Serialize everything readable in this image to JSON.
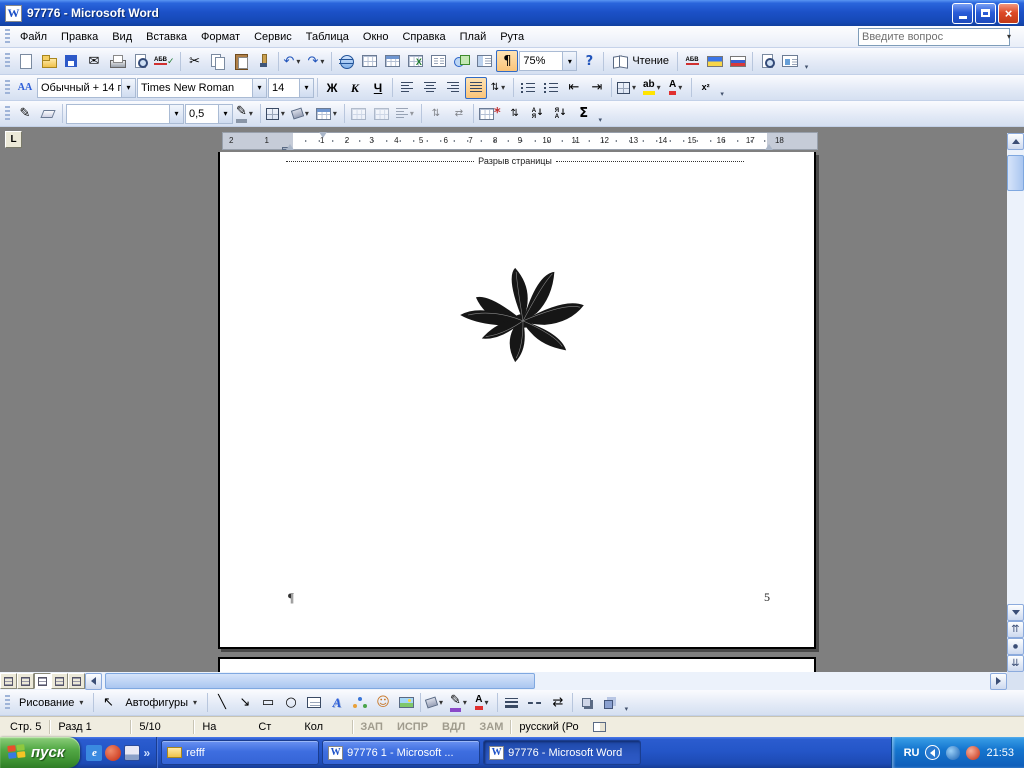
{
  "window": {
    "title": "97776 - Microsoft Word"
  },
  "menubar": {
    "items": [
      "Файл",
      "Правка",
      "Вид",
      "Вставка",
      "Формат",
      "Сервис",
      "Таблица",
      "Окно",
      "Справка",
      "Плай",
      "Рута"
    ],
    "question_placeholder": "Введите вопрос"
  },
  "standard": {
    "spell_text": "АБВ",
    "zoom_value": "75%",
    "read_label": "Чтение"
  },
  "formatting": {
    "styles_icon_text": "АА",
    "style_value": "Обычный + 14 г",
    "font_value": "Times New Roman",
    "size_value": "14",
    "bold": "Ж",
    "italic": "К",
    "underline": "Ч",
    "highlight_text": "ab",
    "fontcolor_text": "А",
    "superscript_text": "х²"
  },
  "tables": {
    "line_weight_value": "0,5",
    "sort_a": "А",
    "sort_z": "Я",
    "autosum": "Σ"
  },
  "drawing": {
    "menu_label": "Рисование",
    "autoshapes_label": "Автофигуры",
    "wordart_letter": "А",
    "fontcolor_letter": "А",
    "textbox_letter": "А"
  },
  "ruler": {
    "tab_selector": "L",
    "left_numbers": [
      "2",
      "1"
    ],
    "numbers": [
      "1",
      "2",
      "3",
      "4",
      "5",
      "6",
      "7",
      "8",
      "9",
      "10",
      "11",
      "12",
      "13",
      "14",
      "15",
      "16",
      "17",
      "18"
    ]
  },
  "document": {
    "page_break_label": "Разрыв страницы",
    "pilcrow": "¶",
    "page_number": "5"
  },
  "statusbar": {
    "page": "Стр. 5",
    "section": "Разд 1",
    "position": "5/10",
    "at_label": "На",
    "line_label": "Ст",
    "col_label": "Кол",
    "toggles": [
      "ЗАП",
      "ИСПР",
      "ВДЛ",
      "ЗАМ"
    ],
    "language": "русский (Ро"
  },
  "taskbar": {
    "start_label": "пуск",
    "tasks": [
      {
        "label": "refff"
      },
      {
        "label": "97776 1 - Microsoft ..."
      },
      {
        "label": "97776 - Microsoft Word"
      }
    ],
    "tray_lang": "RU",
    "time": "21:53"
  },
  "icons": {
    "close": "×",
    "word": "W",
    "mail": "✉",
    "cut": "✂",
    "undo": "↶",
    "redo": "↷",
    "pilcrow": "¶",
    "help": "?",
    "check": "✓",
    "pencil": "✎",
    "line": "╲",
    "arrow": "↘",
    "rect": "▭",
    "oval": "○",
    "select": "↖",
    "spacing": "⇅",
    "indent_dec": "⇤",
    "indent_inc": "⇥",
    "arrows_lr": "⇄",
    "dbl_up": "⇈",
    "dbl_down": "⇊",
    "dot": "●",
    "down": "↓",
    "smile": "☺",
    "star": "*",
    "excel_x": "X",
    "ie": "e",
    "chevron": "»"
  }
}
